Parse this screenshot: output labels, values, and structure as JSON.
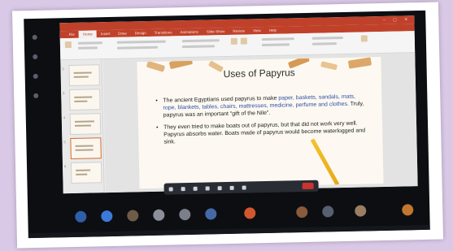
{
  "window": {
    "title_text": "",
    "menu_tabs": [
      "File",
      "Home",
      "Insert",
      "Draw",
      "Design",
      "Transitions",
      "Animations",
      "Slide Show",
      "Review",
      "View",
      "Help"
    ]
  },
  "slide": {
    "title": "Uses of Papyrus",
    "bullet1": {
      "p1": "The ancient Egyptians used papyrus to make ",
      "k1": "paper, baskets,",
      "p2": " ",
      "k2": "sandals, mats, rope, blankets, tables, chairs, mattresses, medicine, perfume and clothes.",
      "p3": " Truly, papyrus was an important “gift of the Nile”."
    },
    "bullet2": "They even tried to make boats out of papyrus, but that did not work very well. Papyrus absorbs water. Boats made of papyrus would become waterlogged and sink."
  },
  "thumbnails": [
    {
      "num": "2",
      "active": false
    },
    {
      "num": "3",
      "active": false
    },
    {
      "num": "4",
      "active": false
    },
    {
      "num": "5",
      "active": true
    },
    {
      "num": "6",
      "active": false
    }
  ],
  "colors": {
    "ppt_accent": "#c0412a",
    "keyword_blue": "#2c4fa3",
    "end_call_red": "#c8342f"
  },
  "meeting_controls": [
    "chat-icon",
    "camera-icon",
    "mic-icon",
    "share-icon",
    "more-icon",
    "grid-icon",
    "upload-icon",
    "end-call-icon"
  ],
  "participants": [
    {
      "initials": "",
      "color": "#2f5fa8"
    },
    {
      "initials": "",
      "color": "#3b7ad9"
    },
    {
      "initials": "",
      "color": "#6e5b48"
    },
    {
      "initials": "",
      "color": "#8a8f99"
    },
    {
      "initials": "",
      "color": "#7a7f89"
    },
    {
      "initials": "",
      "color": "#4568a8"
    },
    {
      "initials": "",
      "color": "#d2572f"
    },
    {
      "initials": "",
      "color": "#8a5a3c"
    },
    {
      "initials": "",
      "color": "#566070"
    },
    {
      "initials": "",
      "color": "#9a7d63"
    },
    {
      "initials": "",
      "color": "#c2762e"
    }
  ]
}
